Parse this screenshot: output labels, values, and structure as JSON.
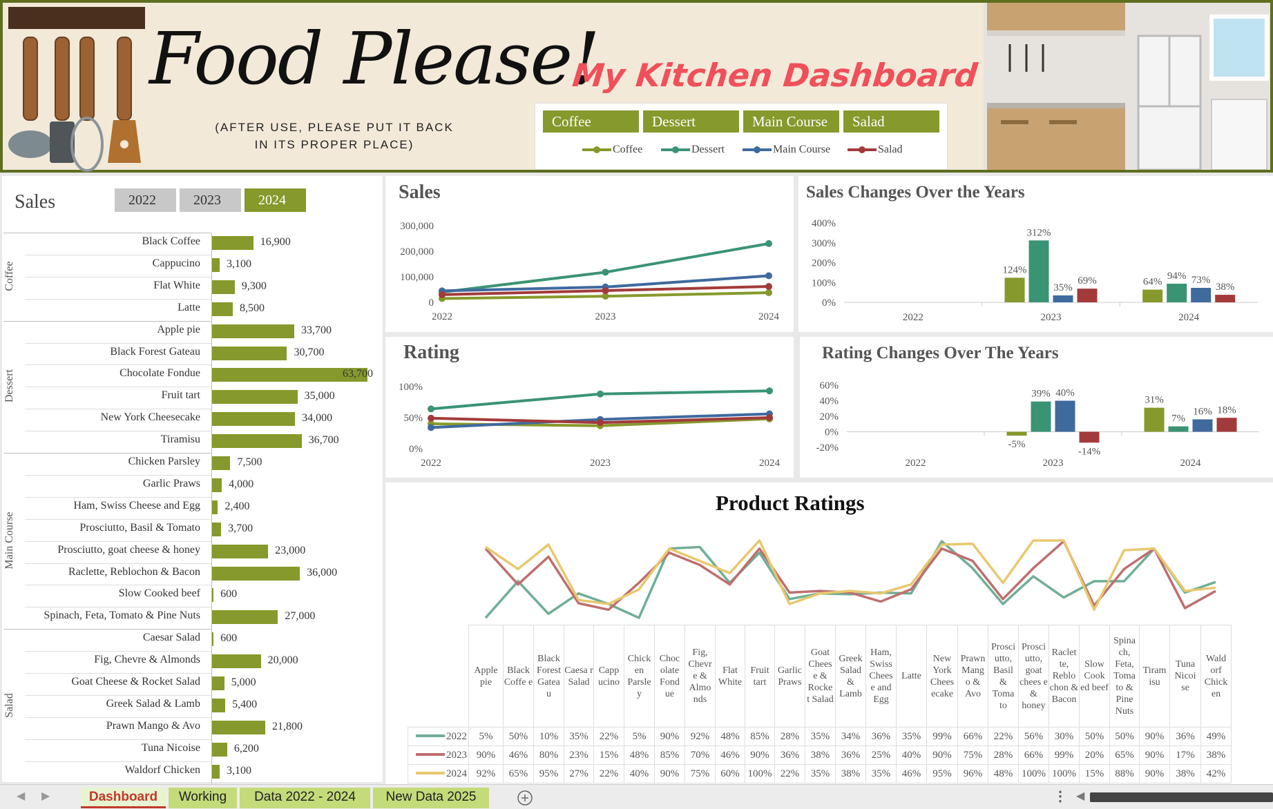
{
  "header": {
    "title": "Food Please!",
    "subtitle": [
      "(AFTER USE, PLEASE PUT IT BACK",
      "IN ITS PROPER PLACE)"
    ],
    "dashboard_title": "My Kitchen Dashboard",
    "slicer_buttons": [
      "Coffee",
      "Dessert",
      "Main Course",
      "Salad"
    ],
    "legend": [
      {
        "label": "Coffee",
        "color": "#86992c"
      },
      {
        "label": "Dessert",
        "color": "#3a9474"
      },
      {
        "label": "Main Course",
        "color": "#3f6a9e"
      },
      {
        "label": "Salad",
        "color": "#a33a3a"
      }
    ]
  },
  "sales_panel": {
    "title": "Sales",
    "years": [
      {
        "label": "2022",
        "active": false
      },
      {
        "label": "2023",
        "active": false
      },
      {
        "label": "2024",
        "active": true
      }
    ],
    "max": 63700,
    "groups": [
      {
        "name": "Coffee",
        "items": [
          {
            "label": "Black Coffee",
            "value": 16900,
            "text": "16,900"
          },
          {
            "label": "Cappucino",
            "value": 3100,
            "text": "3,100"
          },
          {
            "label": "Flat White",
            "value": 9300,
            "text": "9,300"
          },
          {
            "label": "Latte",
            "value": 8500,
            "text": "8,500"
          }
        ]
      },
      {
        "name": "Dessert",
        "items": [
          {
            "label": "Apple pie",
            "value": 33700,
            "text": "33,700"
          },
          {
            "label": "Black Forest Gateau",
            "value": 30700,
            "text": "30,700"
          },
          {
            "label": "Chocolate Fondue",
            "value": 63700,
            "text": "63,700"
          },
          {
            "label": "Fruit tart",
            "value": 35000,
            "text": "35,000"
          },
          {
            "label": "New York Cheesecake",
            "value": 34000,
            "text": "34,000"
          },
          {
            "label": "Tiramisu",
            "value": 36700,
            "text": "36,700"
          }
        ]
      },
      {
        "name": "Main Course",
        "items": [
          {
            "label": "Chicken Parsley",
            "value": 7500,
            "text": "7,500"
          },
          {
            "label": "Garlic Praws",
            "value": 4000,
            "text": "4,000"
          },
          {
            "label": "Ham, Swiss Cheese and Egg",
            "value": 2400,
            "text": "2,400"
          },
          {
            "label": "Prosciutto, Basil & Tomato",
            "value": 3700,
            "text": "3,700"
          },
          {
            "label": "Prosciutto, goat cheese & honey",
            "value": 23000,
            "text": "23,000"
          },
          {
            "label": "Raclette, Reblochon & Bacon",
            "value": 36000,
            "text": "36,000"
          },
          {
            "label": "Slow Cooked beef",
            "value": 600,
            "text": "600"
          },
          {
            "label": "Spinach, Feta, Tomato & Pine Nuts",
            "value": 27000,
            "text": "27,000"
          }
        ]
      },
      {
        "name": "Salad",
        "items": [
          {
            "label": "Caesar Salad",
            "value": 600,
            "text": "600"
          },
          {
            "label": "Fig, Chevre & Almonds",
            "value": 20000,
            "text": "20,000"
          },
          {
            "label": "Goat Cheese & Rocket Salad",
            "value": 5000,
            "text": "5,000"
          },
          {
            "label": "Greek Salad & Lamb",
            "value": 5400,
            "text": "5,400"
          },
          {
            "label": "Prawn Mango & Avo",
            "value": 21800,
            "text": "21,800"
          },
          {
            "label": "Tuna Nicoise",
            "value": 6200,
            "text": "6,200"
          },
          {
            "label": "Waldorf Chicken",
            "value": 3100,
            "text": "3,100"
          }
        ]
      }
    ]
  },
  "chart_data": [
    {
      "type": "line",
      "title": "Sales",
      "x": [
        "2022",
        "2023",
        "2024"
      ],
      "yticks": [
        "0",
        "100,000",
        "200,000",
        "300,000"
      ],
      "ylim": [
        0,
        300000
      ],
      "series": [
        {
          "name": "Coffee",
          "color": "#86992c",
          "values": [
            15000,
            24000,
            38000
          ]
        },
        {
          "name": "Dessert",
          "color": "#3a9474",
          "values": [
            40000,
            118000,
            230000
          ]
        },
        {
          "name": "Main Course",
          "color": "#3f6a9e",
          "values": [
            45000,
            60000,
            104000
          ]
        },
        {
          "name": "Salad",
          "color": "#a33a3a",
          "values": [
            30000,
            46000,
            62000
          ]
        }
      ]
    },
    {
      "type": "bar",
      "title": "Sales Changes Over the Years",
      "categories": [
        "2022",
        "2023",
        "2024"
      ],
      "yticks": [
        "0%",
        "100%",
        "200%",
        "300%",
        "400%"
      ],
      "ylim": [
        0,
        400
      ],
      "series": [
        {
          "name": "Coffee",
          "color": "#86992c",
          "values": [
            null,
            124,
            64
          ],
          "labels": [
            "",
            "124%",
            "64%"
          ]
        },
        {
          "name": "Dessert",
          "color": "#3a9474",
          "values": [
            null,
            312,
            94
          ],
          "labels": [
            "",
            "312%",
            "94%"
          ]
        },
        {
          "name": "Main Course",
          "color": "#3f6a9e",
          "values": [
            null,
            35,
            73
          ],
          "labels": [
            "",
            "35%",
            "73%"
          ]
        },
        {
          "name": "Salad",
          "color": "#a33a3a",
          "values": [
            null,
            69,
            38
          ],
          "labels": [
            "",
            "69%",
            "38%"
          ]
        }
      ]
    },
    {
      "type": "line",
      "title": "Rating",
      "x": [
        "2022",
        "2023",
        "2024"
      ],
      "yticks": [
        "0%",
        "50%",
        "100%"
      ],
      "ylim": [
        0,
        100
      ],
      "series": [
        {
          "name": "Coffee",
          "color": "#86992c",
          "values": [
            40,
            37,
            48
          ]
        },
        {
          "name": "Dessert",
          "color": "#3a9474",
          "values": [
            64,
            88,
            93
          ]
        },
        {
          "name": "Main Course",
          "color": "#3f6a9e",
          "values": [
            34,
            47,
            56
          ]
        },
        {
          "name": "Salad",
          "color": "#a33a3a",
          "values": [
            49,
            42,
            50
          ]
        }
      ]
    },
    {
      "type": "bar",
      "title": "Rating Changes Over The Years",
      "categories": [
        "2022",
        "2023",
        "2024"
      ],
      "yticks": [
        "-20%",
        "0%",
        "20%",
        "40%",
        "60%"
      ],
      "ylim": [
        -20,
        60
      ],
      "series": [
        {
          "name": "Coffee",
          "color": "#86992c",
          "values": [
            null,
            -5,
            31
          ],
          "labels": [
            "",
            "-5%",
            "31%"
          ]
        },
        {
          "name": "Dessert",
          "color": "#3a9474",
          "values": [
            null,
            39,
            7
          ],
          "labels": [
            "",
            "39%",
            "7%"
          ]
        },
        {
          "name": "Main Course",
          "color": "#3f6a9e",
          "values": [
            null,
            40,
            16
          ],
          "labels": [
            "",
            "40%",
            "16%"
          ]
        },
        {
          "name": "Salad",
          "color": "#a33a3a",
          "values": [
            null,
            -14,
            18
          ],
          "labels": [
            "",
            "-14%",
            "18%"
          ]
        }
      ]
    },
    {
      "type": "line",
      "title": "Product Ratings",
      "categories": [
        "Apple pie",
        "Black Coffee",
        "Black Forest Gateau",
        "Caesar Salad",
        "Cappucino",
        "Chicken Parsley",
        "Chocolate Fondue",
        "Fig, Chevre & Almonds",
        "Flat White",
        "Fruit tart",
        "Garlic Praws",
        "Goat Cheese & Rocket Salad",
        "Greek Salad & Lamb",
        "Ham, Swiss Cheese and Egg",
        "Latte",
        "New York Cheesecake",
        "Prawn Mango & Avo",
        "Prosciutto, Basil & Tomato",
        "Prosciutto, goat cheese & honey",
        "Raclette, Reblochon & Bacon",
        "Slow Cooked beef",
        "Spinach, Feta, Tomato & Pine Nuts",
        "Tiramisu",
        "Tuna Nicoise",
        "Waldorf Chicken"
      ],
      "ylim": [
        0,
        100
      ],
      "series": [
        {
          "name": "2022",
          "color": "#6fae95",
          "values": [
            5,
            50,
            10,
            35,
            22,
            5,
            90,
            92,
            48,
            85,
            28,
            35,
            34,
            36,
            35,
            99,
            66,
            22,
            56,
            30,
            50,
            50,
            90,
            36,
            49
          ],
          "labels": [
            "5%",
            "50%",
            "10%",
            "35%",
            "22%",
            "5%",
            "90%",
            "92%",
            "48%",
            "85%",
            "28%",
            "35%",
            "34%",
            "36%",
            "35%",
            "99%",
            "66%",
            "22%",
            "56%",
            "30%",
            "50%",
            "50%",
            "90%",
            "36%",
            "49%"
          ]
        },
        {
          "name": "2023",
          "color": "#bf6e6e",
          "values": [
            90,
            46,
            80,
            23,
            15,
            48,
            85,
            70,
            46,
            90,
            36,
            38,
            36,
            25,
            40,
            90,
            75,
            28,
            66,
            99,
            20,
            65,
            90,
            17,
            38
          ],
          "labels": [
            "90%",
            "46%",
            "80%",
            "23%",
            "15%",
            "48%",
            "85%",
            "70%",
            "46%",
            "90%",
            "36%",
            "38%",
            "36%",
            "25%",
            "40%",
            "90%",
            "75%",
            "28%",
            "66%",
            "99%",
            "20%",
            "65%",
            "90%",
            "17%",
            "38%"
          ]
        },
        {
          "name": "2024",
          "color": "#e8c86e",
          "values": [
            92,
            65,
            95,
            27,
            22,
            40,
            90,
            75,
            60,
            100,
            22,
            35,
            38,
            35,
            46,
            95,
            96,
            48,
            100,
            100,
            15,
            88,
            90,
            38,
            42
          ],
          "labels": [
            "92%",
            "65%",
            "95%",
            "27%",
            "22%",
            "40%",
            "90%",
            "75%",
            "60%",
            "100%",
            "22%",
            "35%",
            "38%",
            "35%",
            "46%",
            "95%",
            "96%",
            "48%",
            "100%",
            "100%",
            "15%",
            "88%",
            "90%",
            "38%",
            "42%"
          ]
        }
      ]
    }
  ],
  "product_headers": [
    "Apple pie",
    "Black Coffe e",
    "Black Forest Gatea u",
    "Caesa r Salad",
    "Capp ucino",
    "Chick en Parsle y",
    "Choc olate Fond ue",
    "Fig, Chevr e & Almo nds",
    "Flat White",
    "Fruit tart",
    "Garlic Praws",
    "Goat Chees e & Rocke t Salad",
    "Greek Salad & Lamb",
    "Ham, Swiss Chees e and Egg",
    "Latte",
    "New York Chees ecake",
    "Prawn Mang o & Avo",
    "Prosci utto, Basil & Toma to",
    "Prosci utto, goat chees e & honey",
    "Raclet te, Reblo chon & Bacon",
    "Slow Cook ed beef",
    "Spina ch, Feta, Toma to & Pine Nuts",
    "Tiram isu",
    "Tuna Nicoi se",
    "Wald orf Chick en"
  ],
  "tabs": [
    {
      "label": "Dashboard",
      "active": true
    },
    {
      "label": "Working",
      "active": false
    },
    {
      "label": "Data 2022 - 2024",
      "active": false
    },
    {
      "label": "New Data 2025",
      "active": false
    }
  ],
  "icons": {
    "add_sheet": "plus-circle-icon",
    "more": "vertical-ellipsis-icon",
    "nav_prev": "chevron-left-icon",
    "nav_next": "chevron-right-icon"
  },
  "colors": {
    "accent": "#86992c",
    "header_bg": "#f2e9d9",
    "border": "#5e6e1f",
    "title_red": "#f0505a"
  }
}
